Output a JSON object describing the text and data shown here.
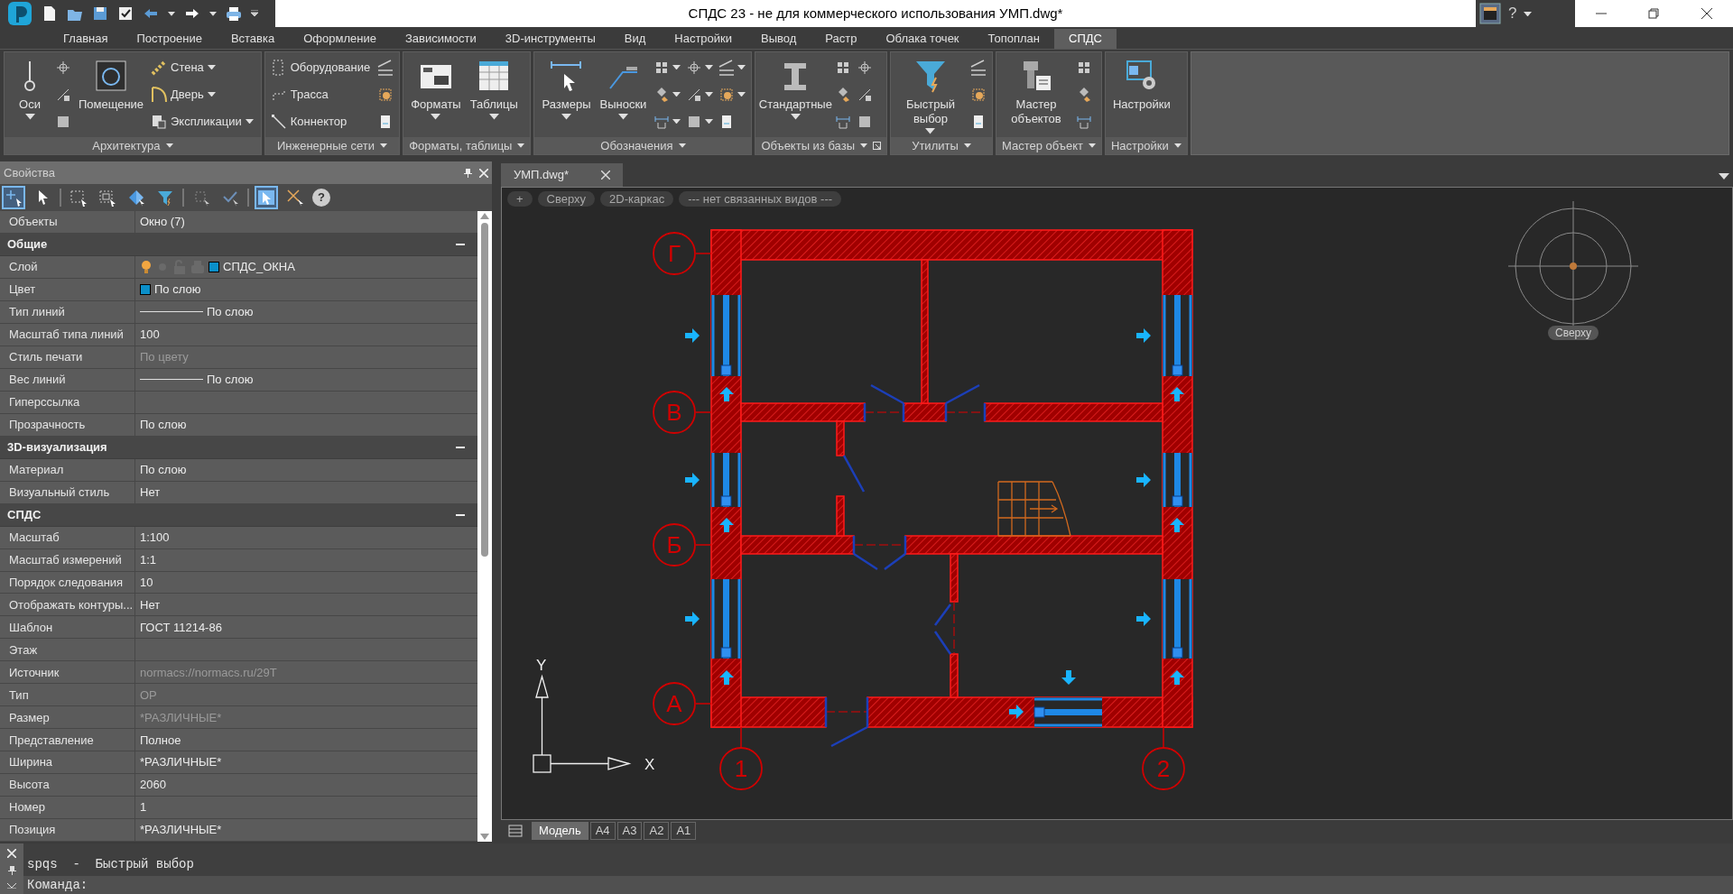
{
  "title_bar": {
    "title": "СПДС 23 - не для коммерческого использования УМП.dwg*",
    "help_label": "?"
  },
  "menu_tabs": [
    {
      "label": "Главная",
      "selected": false
    },
    {
      "label": "Построение",
      "selected": false
    },
    {
      "label": "Вставка",
      "selected": false
    },
    {
      "label": "Оформление",
      "selected": false
    },
    {
      "label": "Зависимости",
      "selected": false
    },
    {
      "label": "3D-инструменты",
      "selected": false
    },
    {
      "label": "Вид",
      "selected": false
    },
    {
      "label": "Настройки",
      "selected": false
    },
    {
      "label": "Вывод",
      "selected": false
    },
    {
      "label": "Растр",
      "selected": false
    },
    {
      "label": "Облака точек",
      "selected": false
    },
    {
      "label": "Топоплан",
      "selected": false
    },
    {
      "label": "СПДС",
      "selected": true
    }
  ],
  "ribbon_panels": [
    {
      "title": "Архитектура",
      "caret": true,
      "launcher": false,
      "items": [
        {
          "kind": "large",
          "label": "Оси",
          "caret": true
        },
        {
          "kind": "icon",
          "caret": false
        },
        {
          "kind": "icon",
          "caret": false
        },
        {
          "kind": "icon",
          "caret": false
        },
        {
          "kind": "large",
          "label": "Помещение",
          "caret": false
        },
        {
          "kind": "small",
          "label": "Стена",
          "caret": true
        },
        {
          "kind": "small",
          "label": "Дверь",
          "caret": true
        },
        {
          "kind": "small",
          "label": "Экспликации",
          "caret": true
        }
      ]
    },
    {
      "title": "Инженерные сети",
      "caret": true,
      "launcher": false,
      "items": [
        {
          "kind": "small",
          "label": "Оборудование",
          "caret": false
        },
        {
          "kind": "small",
          "label": "Трасса",
          "caret": false
        },
        {
          "kind": "small",
          "label": "Коннектор",
          "caret": false
        },
        {
          "kind": "icon",
          "caret": false
        },
        {
          "kind": "icon",
          "caret": false
        },
        {
          "kind": "icon",
          "caret": false
        }
      ]
    },
    {
      "title": "Форматы, таблицы",
      "caret": true,
      "launcher": false,
      "items": [
        {
          "kind": "large",
          "label": "Форматы",
          "caret": true
        },
        {
          "kind": "large",
          "label": "Таблицы",
          "caret": true
        }
      ]
    },
    {
      "title": "Обозначения",
      "caret": true,
      "launcher": false,
      "items": [
        {
          "kind": "large",
          "label": "Размеры",
          "caret": true
        },
        {
          "kind": "large",
          "label": "Выноски",
          "caret": true
        },
        {
          "kind": "icon",
          "caret": true
        },
        {
          "kind": "icon",
          "caret": true
        },
        {
          "kind": "icon",
          "caret": true
        },
        {
          "kind": "icon",
          "caret": true
        },
        {
          "kind": "icon",
          "caret": true
        },
        {
          "kind": "icon",
          "caret": true
        },
        {
          "kind": "icon",
          "caret": true
        },
        {
          "kind": "icon",
          "caret": true
        },
        {
          "kind": "icon",
          "caret": false
        }
      ]
    },
    {
      "title": "Объекты из базы",
      "caret": true,
      "launcher": true,
      "items": [
        {
          "kind": "large",
          "label": "Стандартные",
          "caret": true
        },
        {
          "kind": "icon",
          "caret": false
        },
        {
          "kind": "icon",
          "caret": false
        },
        {
          "kind": "icon",
          "caret": false
        },
        {
          "kind": "icon",
          "caret": false
        },
        {
          "kind": "icon",
          "caret": false
        },
        {
          "kind": "icon",
          "caret": false
        }
      ]
    },
    {
      "title": "Утилиты",
      "caret": true,
      "launcher": false,
      "items": [
        {
          "kind": "large",
          "label": "Быстрый выбор",
          "caret": true
        },
        {
          "kind": "icon",
          "caret": false
        },
        {
          "kind": "icon",
          "caret": false
        },
        {
          "kind": "icon",
          "caret": false
        }
      ]
    },
    {
      "title": "Мастер объект",
      "caret": true,
      "launcher": false,
      "items": [
        {
          "kind": "large",
          "label": "Мастер объектов",
          "caret": false
        },
        {
          "kind": "icon",
          "caret": false
        },
        {
          "kind": "icon",
          "caret": false
        },
        {
          "kind": "icon",
          "caret": false
        }
      ]
    },
    {
      "title": "Настройки",
      "caret": true,
      "launcher": false,
      "items": [
        {
          "kind": "large",
          "label": "Настройки",
          "caret": false
        }
      ]
    }
  ],
  "properties": {
    "title": "Свойства",
    "toolbar": [
      {
        "kind": "add",
        "selected": true
      },
      {
        "kind": "pointer",
        "selected": false
      },
      {
        "kind": "separator",
        "selected": false
      },
      {
        "kind": "window",
        "selected": false
      },
      {
        "kind": "crossing",
        "selected": false
      },
      {
        "kind": "arrows",
        "selected": false
      },
      {
        "kind": "filter",
        "selected": false
      },
      {
        "kind": "separator",
        "selected": false
      },
      {
        "kind": "grid",
        "selected": false
      },
      {
        "kind": "check",
        "selected": false
      },
      {
        "kind": "separator",
        "selected": false
      },
      {
        "kind": "pick",
        "selected": true
      },
      {
        "kind": "cancel",
        "selected": false
      },
      {
        "kind": "help",
        "selected": false,
        "label": "?"
      }
    ],
    "rows": [
      {
        "kind": "text",
        "label": "Объекты",
        "value": "Окно (7)",
        "dimmed": false
      },
      {
        "kind": "section",
        "label": "Общие",
        "expanded": true
      },
      {
        "kind": "layer",
        "label": "Слой",
        "value": "СПДС_ОКНА",
        "color": "#0a8fc9",
        "dimmed": false
      },
      {
        "kind": "color",
        "label": "Цвет",
        "value": "По слою",
        "color": "#0a8fc9",
        "dimmed": false
      },
      {
        "kind": "linetype",
        "label": "Тип линий",
        "value": "По слою",
        "dimmed": false
      },
      {
        "kind": "text",
        "label": "Масштаб типа линий",
        "value": "100",
        "dimmed": false
      },
      {
        "kind": "text",
        "label": "Стиль печати",
        "value": "По цвету",
        "dimmed": true
      },
      {
        "kind": "linetype",
        "label": "Вес линий",
        "value": "По слою",
        "dimmed": false
      },
      {
        "kind": "text",
        "label": "Гиперссылка"
      },
      {
        "kind": "text",
        "label": "Прозрачность",
        "value": "По слою",
        "dimmed": false
      },
      {
        "kind": "section",
        "label": "3D-визуализация",
        "expanded": true
      },
      {
        "kind": "text",
        "label": "Материал",
        "value": "По слою",
        "dimmed": false
      },
      {
        "kind": "text",
        "label": "Визуальный стиль",
        "value": "Нет",
        "dimmed": false
      },
      {
        "kind": "section",
        "label": "СПДС",
        "expanded": true
      },
      {
        "kind": "text",
        "label": "Масштаб",
        "value": "1:100",
        "dimmed": false
      },
      {
        "kind": "text",
        "label": "Масштаб измерений",
        "value": "1:1",
        "dimmed": false
      },
      {
        "kind": "text",
        "label": "Порядок следования",
        "value": "10",
        "dimmed": false
      },
      {
        "kind": "text",
        "label": "Отображать контуры...",
        "value": "Нет",
        "dimmed": false
      },
      {
        "kind": "text",
        "label": "Шаблон",
        "value": "ГОСТ 11214-86",
        "dimmed": false
      },
      {
        "kind": "text",
        "label": "Этаж"
      },
      {
        "kind": "text",
        "label": "Источник",
        "value": "normacs://normacs.ru/29T",
        "dimmed": true
      },
      {
        "kind": "text",
        "label": "Тип",
        "value": "ОР",
        "dimmed": true
      },
      {
        "kind": "text",
        "label": "Размер",
        "value": "*РАЗЛИЧНЫЕ*",
        "dimmed": true
      },
      {
        "kind": "text",
        "label": "Представление",
        "value": "Полное",
        "dimmed": false
      },
      {
        "kind": "text",
        "label": "Ширина",
        "value": "*РАЗЛИЧНЫЕ*",
        "dimmed": false
      },
      {
        "kind": "text",
        "label": "Высота",
        "value": "2060",
        "dimmed": false
      },
      {
        "kind": "text",
        "label": "Номер",
        "value": "1",
        "dimmed": false
      },
      {
        "kind": "text",
        "label": "Позиция",
        "value": "*РАЗЛИЧНЫЕ*",
        "dimmed": false
      }
    ]
  },
  "document_tab": {
    "label": "УМП.dwg*"
  },
  "view_controls": [
    "+",
    "Сверху",
    "2D-каркас",
    "--- нет связанных видов ---"
  ],
  "view_cube": {
    "label": "Сверху"
  },
  "drawing": {
    "row_axes": [
      "Г",
      "В",
      "Б",
      "А"
    ],
    "column_axes": [
      "1",
      "2"
    ],
    "ucs": {
      "x_label": "X",
      "y_label": "Y"
    }
  },
  "layout_tabs": [
    {
      "label": "Модель",
      "selected": true
    },
    {
      "label": "A4",
      "selected": false
    },
    {
      "label": "A3",
      "selected": false
    },
    {
      "label": "A2",
      "selected": false
    },
    {
      "label": "A1",
      "selected": false
    }
  ],
  "command_line": {
    "history": "spqs  -  Быстрый выбор",
    "prompt": "Команда:"
  }
}
